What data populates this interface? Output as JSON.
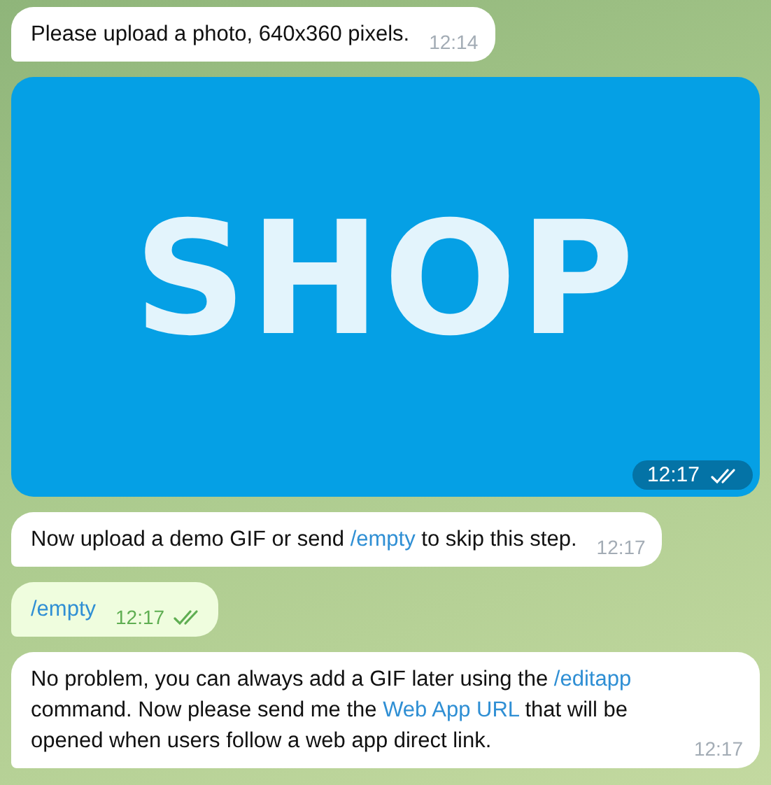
{
  "messages": [
    {
      "kind": "text",
      "outgoing": false,
      "parts": [
        {
          "text": "Please upload a photo, 640x360 pixels.",
          "link": false
        }
      ],
      "time": "12:14"
    },
    {
      "kind": "image",
      "outgoing": true,
      "caption": "SHOP",
      "time": "12:17",
      "read": true
    },
    {
      "kind": "text",
      "outgoing": false,
      "parts": [
        {
          "text": "Now upload a demo GIF or send ",
          "link": false
        },
        {
          "text": "/empty",
          "link": true
        },
        {
          "text": " to skip this step.",
          "link": false
        }
      ],
      "time": "12:17"
    },
    {
      "kind": "text",
      "outgoing": true,
      "parts": [
        {
          "text": "/empty",
          "link": true
        }
      ],
      "time": "12:17",
      "read": true
    },
    {
      "kind": "text",
      "outgoing": false,
      "parts": [
        {
          "text": "No problem, you can always add a GIF later using the ",
          "link": false
        },
        {
          "text": "/editapp",
          "link": true
        },
        {
          "text": " command. Now please send me the ",
          "link": false
        },
        {
          "text": "Web App URL",
          "link": true
        },
        {
          "text": " that will be opened when users follow a web app direct link.",
          "link": false
        }
      ],
      "time": "12:17"
    }
  ]
}
